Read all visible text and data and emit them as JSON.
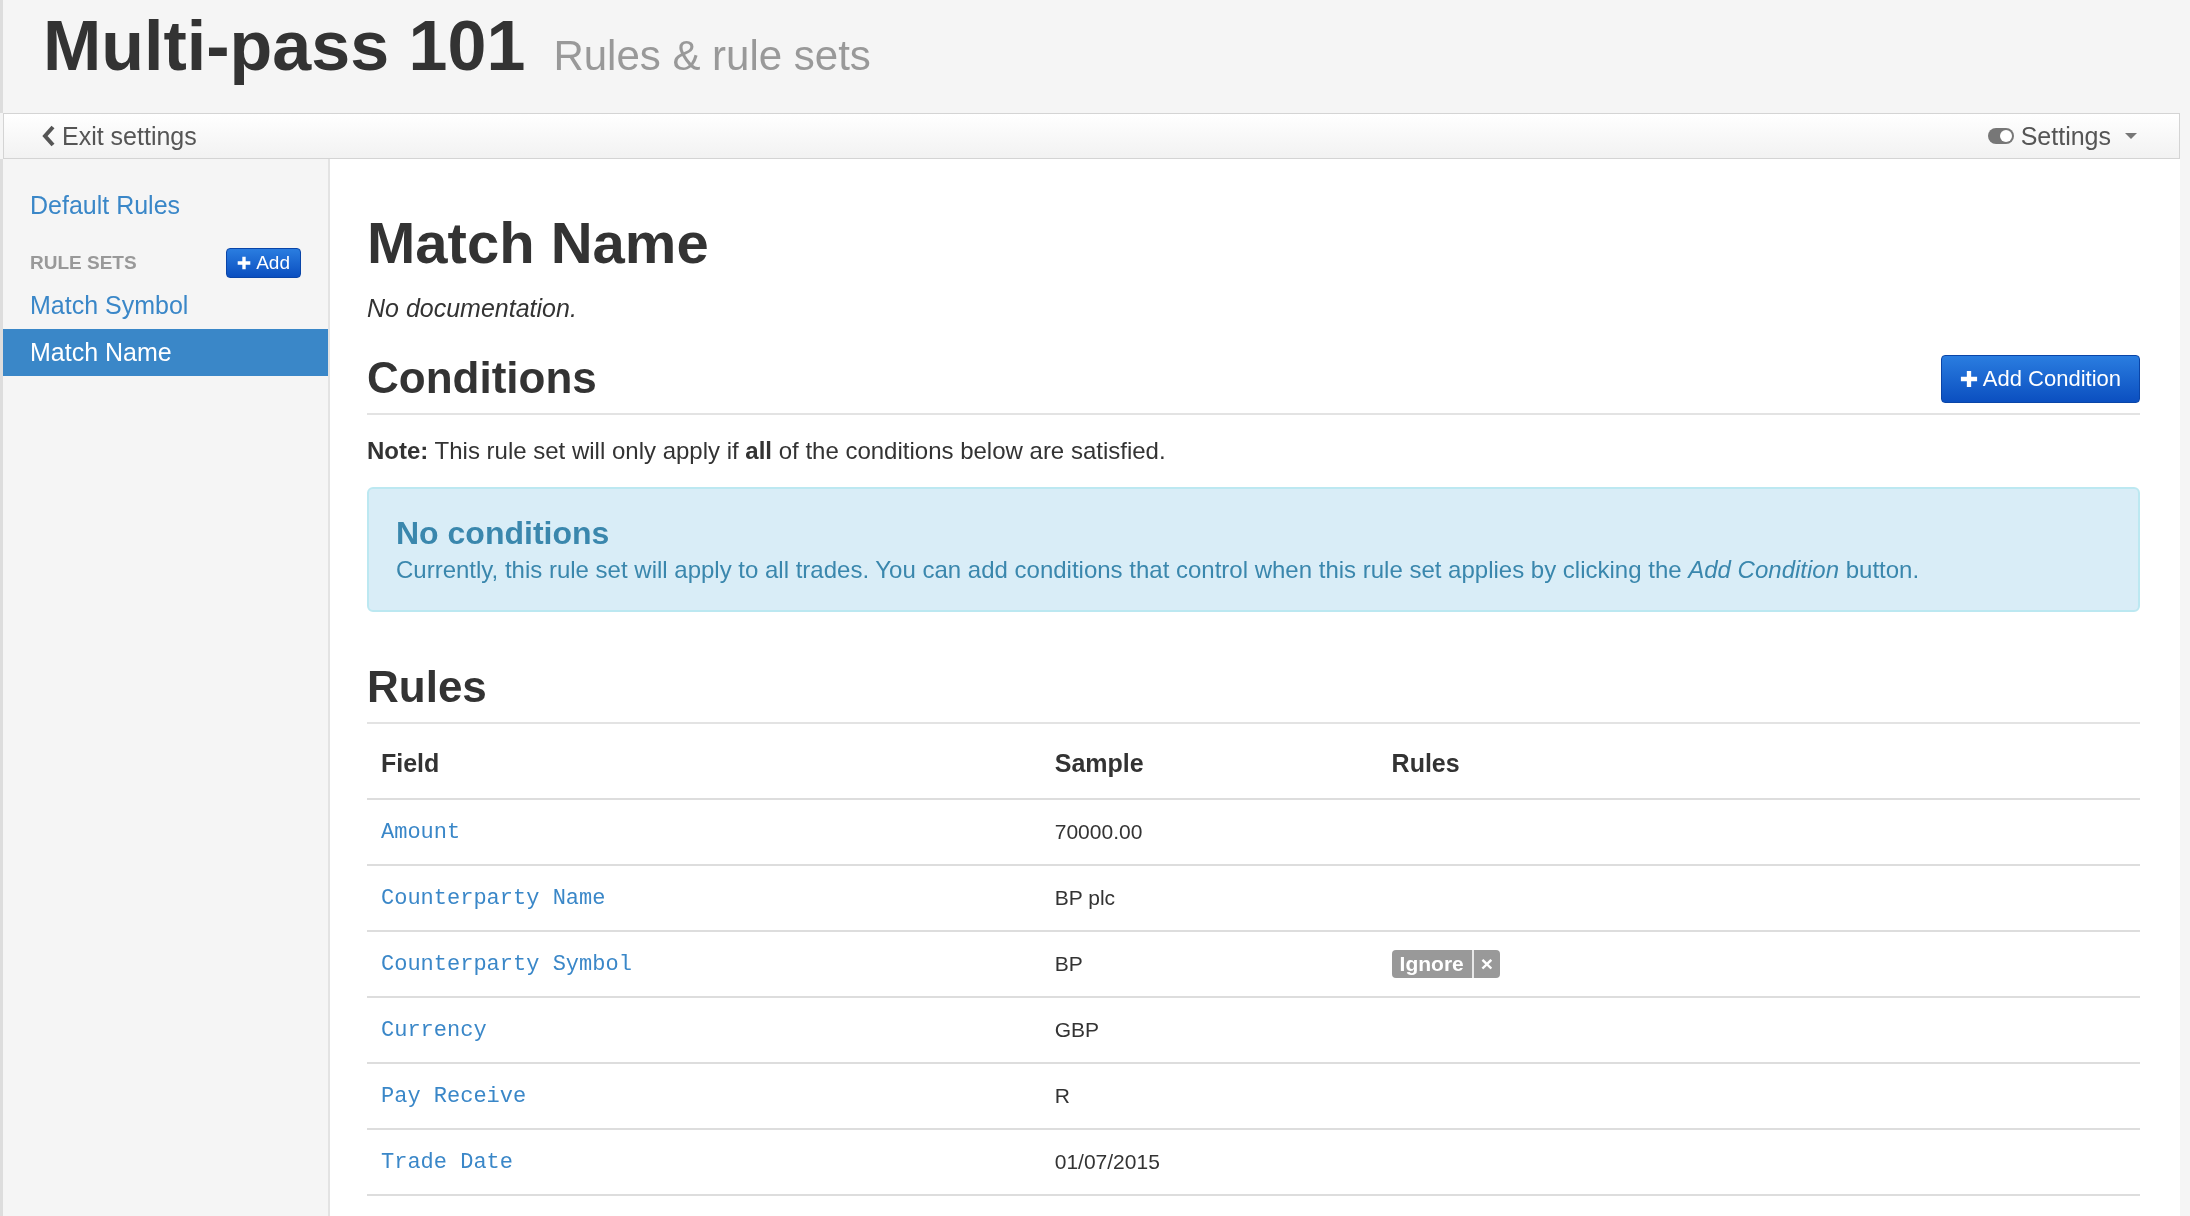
{
  "header": {
    "title": "Multi-pass 101",
    "subtitle": "Rules & rule sets"
  },
  "navbar": {
    "back": "Exit settings",
    "settings": "Settings"
  },
  "sidebar": {
    "default": "Default Rules",
    "section": "RULE SETS",
    "add": "Add",
    "items": [
      {
        "label": "Match Symbol",
        "selected": false
      },
      {
        "label": "Match Name",
        "selected": true
      }
    ]
  },
  "main": {
    "title": "Match Name",
    "documentation": "No documentation.",
    "conditions_heading": "Conditions",
    "add_condition": "Add Condition",
    "note": "**Note:** This rule set will only apply if **all** of the conditions below are satisfied.",
    "alert": {
      "title": "No conditions",
      "text": "Currently, this rule set will apply to all trades. You can add conditions that control when this rule set applies by clicking the *Add Condition* button."
    },
    "rules_heading": "Rules",
    "table": {
      "columns": [
        "Field",
        "Sample",
        "Rules"
      ],
      "rows": [
        {
          "field": "Amount",
          "sample": "70000.00",
          "tags": []
        },
        {
          "field": "Counterparty Name",
          "sample": "BP plc",
          "tags": []
        },
        {
          "field": "Counterparty Symbol",
          "sample": "BP",
          "tags": [
            {
              "label": "Ignore",
              "remove": "×"
            }
          ]
        },
        {
          "field": "Currency",
          "sample": "GBP",
          "tags": []
        },
        {
          "field": "Pay Receive",
          "sample": "R",
          "tags": []
        },
        {
          "field": "Trade Date",
          "sample": "01/07/2015",
          "tags": []
        }
      ]
    }
  }
}
